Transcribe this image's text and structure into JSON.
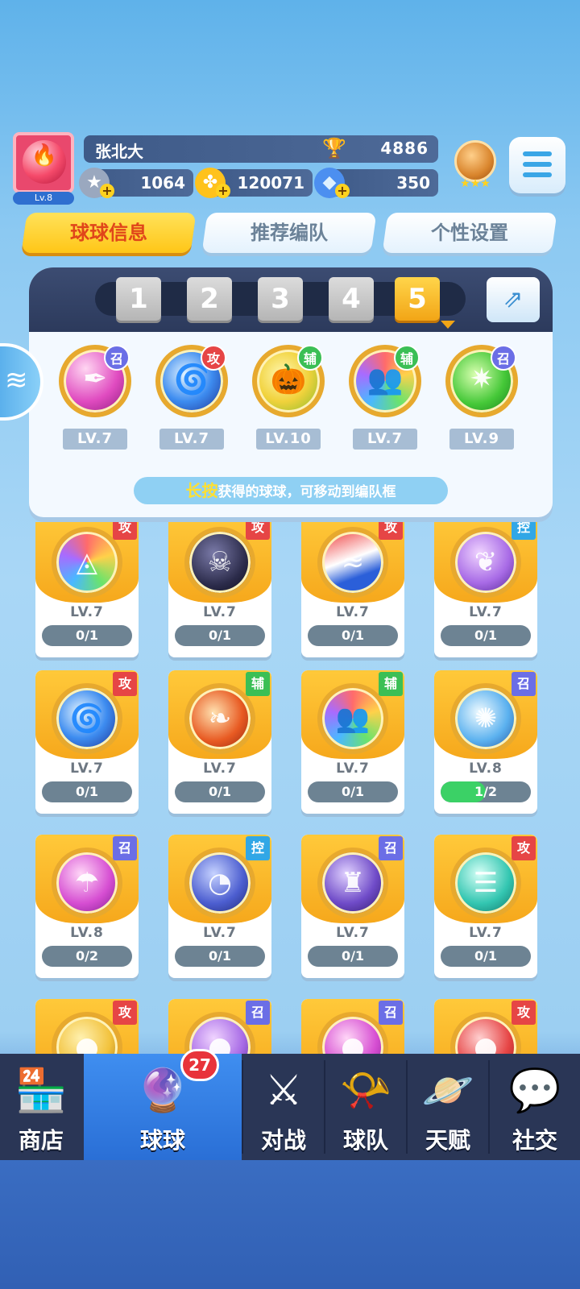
{
  "player": {
    "name": "张北大",
    "level": "Lv.8",
    "trophies": "4886",
    "stars": "1064",
    "coins": "120071",
    "gems": "350"
  },
  "tabs": [
    "球球信息",
    "推荐编队",
    "个性设置"
  ],
  "team": {
    "slots": [
      "1",
      "2",
      "3",
      "4",
      "5"
    ],
    "active_slot": "5",
    "balls": [
      {
        "type": "召",
        "level": "LV.7",
        "icon": "feather-icon",
        "color": "pink"
      },
      {
        "type": "攻",
        "level": "LV.7",
        "icon": "vortex-icon",
        "color": "blue"
      },
      {
        "type": "辅",
        "level": "LV.10",
        "icon": "pumpkin-icon",
        "color": "yellow"
      },
      {
        "type": "辅",
        "level": "LV.7",
        "icon": "crowd-icon",
        "color": "rainbow"
      },
      {
        "type": "召",
        "level": "LV.9",
        "icon": "star-icon",
        "color": "green"
      }
    ],
    "hint_highlight": "长按",
    "hint_text": "获得的球球，可移动到编队框"
  },
  "collection": [
    {
      "type": "攻",
      "level": "LV.7",
      "progress": "0/1",
      "progress_fraction": 0,
      "icon": "prism-icon",
      "color": "rainbow"
    },
    {
      "type": "攻",
      "level": "LV.7",
      "progress": "0/1",
      "progress_fraction": 0,
      "icon": "venom-icon",
      "color": "dark"
    },
    {
      "type": "攻",
      "level": "LV.7",
      "progress": "0/1",
      "progress_fraction": 0,
      "icon": "wave-icon",
      "color": "redblue"
    },
    {
      "type": "控",
      "level": "LV.7",
      "progress": "0/1",
      "progress_fraction": 0,
      "icon": "butterfly-icon",
      "color": "purple"
    },
    {
      "type": "攻",
      "level": "LV.7",
      "progress": "0/1",
      "progress_fraction": 0,
      "icon": "vortex-icon",
      "color": "blue"
    },
    {
      "type": "辅",
      "level": "LV.7",
      "progress": "0/1",
      "progress_fraction": 0,
      "icon": "phoenix-icon",
      "color": "orange"
    },
    {
      "type": "辅",
      "level": "LV.7",
      "progress": "0/1",
      "progress_fraction": 0,
      "icon": "crowd-icon",
      "color": "rainbow"
    },
    {
      "type": "召",
      "level": "LV.8",
      "progress": "1/2",
      "progress_fraction": 0.5,
      "icon": "swirl-icon",
      "color": "skyblue"
    },
    {
      "type": "召",
      "level": "LV.8",
      "progress": "0/2",
      "progress_fraction": 0,
      "icon": "mushroom-icon",
      "color": "magenta"
    },
    {
      "type": "控",
      "level": "LV.7",
      "progress": "0/1",
      "progress_fraction": 0,
      "icon": "clock-icon",
      "color": "indigo"
    },
    {
      "type": "召",
      "level": "LV.7",
      "progress": "0/1",
      "progress_fraction": 0,
      "icon": "ghost-icon",
      "color": "violet"
    },
    {
      "type": "攻",
      "level": "LV.7",
      "progress": "0/1",
      "progress_fraction": 0,
      "icon": "tornado-icon",
      "color": "teal"
    },
    {
      "type": "攻",
      "level": "",
      "progress": "",
      "progress_fraction": 0,
      "icon": "orb-icon",
      "color": "gold"
    },
    {
      "type": "召",
      "level": "",
      "progress": "",
      "progress_fraction": 0,
      "icon": "orb-icon",
      "color": "purple"
    },
    {
      "type": "召",
      "level": "",
      "progress": "",
      "progress_fraction": 0,
      "icon": "orb-icon",
      "color": "magenta"
    },
    {
      "type": "攻",
      "level": "",
      "progress": "",
      "progress_fraction": 0,
      "icon": "orb-icon",
      "color": "red"
    }
  ],
  "nav": [
    {
      "label": "商店",
      "icon": "shop-icon"
    },
    {
      "label": "球球",
      "icon": "balls-icon",
      "badge": "27"
    },
    {
      "label": "对战",
      "icon": "crossed-swords-icon"
    },
    {
      "label": "球队",
      "icon": "whistle-icon"
    },
    {
      "label": "天赋",
      "icon": "planet-icon"
    },
    {
      "label": "社交",
      "icon": "chat-heart-icon"
    }
  ],
  "colors": {
    "attack": "#e64545",
    "summon": "#6b6ee6",
    "support": "#3bbf55",
    "control": "#31a7e6",
    "active_tab": "#ffc617",
    "nav_active": "#2a6fd6"
  }
}
